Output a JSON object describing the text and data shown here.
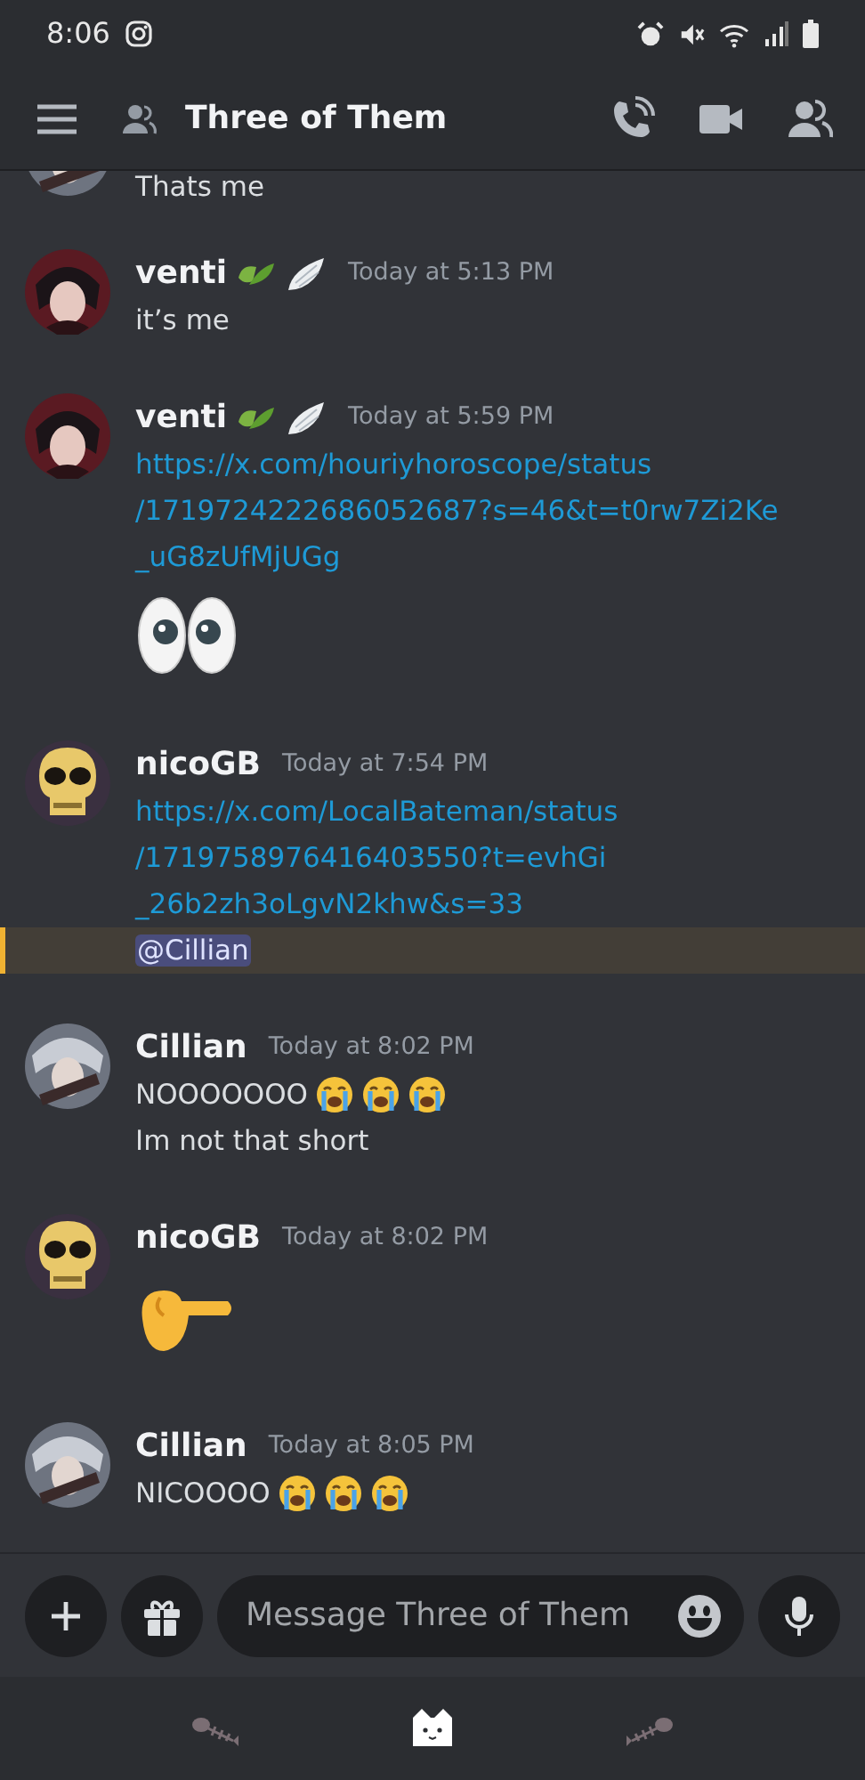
{
  "status_bar": {
    "time": "8:06"
  },
  "header": {
    "title": "Three of Them"
  },
  "messages": [
    {
      "avatar": {
        "kind": "light"
      },
      "lines": [
        {
          "kind": "text",
          "text": "Thats me"
        }
      ]
    },
    {
      "avatar": {
        "kind": "dark"
      },
      "author": "venti",
      "badges": [
        {
          "kind": "leaf"
        },
        {
          "kind": "wing"
        }
      ],
      "time": "Today at 5:13 PM",
      "lines": [
        {
          "kind": "text",
          "text": "it’s me"
        }
      ]
    },
    {
      "avatar": {
        "kind": "dark"
      },
      "author": "venti",
      "badges": [
        {
          "kind": "leaf"
        },
        {
          "kind": "wing"
        }
      ],
      "time": "Today at 5:59 PM",
      "lines": [
        {
          "kind": "link",
          "parts": [
            "https://x.com/houriyhoroscope/status",
            "/1719724222686052687?s=46&t=t0rw7Zi2Ke",
            "_uG8zUfMjUGg"
          ]
        },
        {
          "kind": "emoji",
          "emoji": [
            {
              "kind": "eyes"
            }
          ]
        }
      ]
    },
    {
      "avatar": {
        "kind": "skull"
      },
      "author": "nicoGB",
      "time": "Today at 7:54 PM",
      "lines": [
        {
          "kind": "link",
          "parts": [
            "https://x.com/LocalBateman/status",
            "/1719758976416403550?t=evhGi",
            "_26b2zh3oLgvN2khw&s=33"
          ]
        },
        {
          "kind": "mention",
          "text": "@Cillian",
          "highlighted": true
        }
      ]
    },
    {
      "avatar": {
        "kind": "light"
      },
      "author": "Cillian",
      "time": "Today at 8:02 PM",
      "lines": [
        {
          "kind": "text",
          "text": "NOOOOOOO",
          "emoji": [
            {
              "kind": "crying"
            },
            {
              "kind": "crying"
            },
            {
              "kind": "crying"
            }
          ]
        },
        {
          "kind": "text",
          "text": "Im not that short"
        }
      ]
    },
    {
      "avatar": {
        "kind": "skull"
      },
      "author": "nicoGB",
      "time": "Today at 8:02 PM",
      "lines": [
        {
          "kind": "emoji",
          "emoji": [
            {
              "kind": "pointing"
            }
          ]
        }
      ]
    },
    {
      "avatar": {
        "kind": "light"
      },
      "author": "Cillian",
      "time": "Today at 8:05 PM",
      "lines": [
        {
          "kind": "text",
          "text": "NICOOOO",
          "emoji": [
            {
              "kind": "crying"
            },
            {
              "kind": "crying"
            },
            {
              "kind": "crying"
            }
          ]
        }
      ]
    }
  ],
  "composer": {
    "placeholder": "Message Three of Them"
  },
  "bottom_nav": [
    {
      "kind": "fish",
      "selected": false
    },
    {
      "kind": "cat",
      "selected": true
    },
    {
      "kind": "fish",
      "selected": false
    }
  ]
}
